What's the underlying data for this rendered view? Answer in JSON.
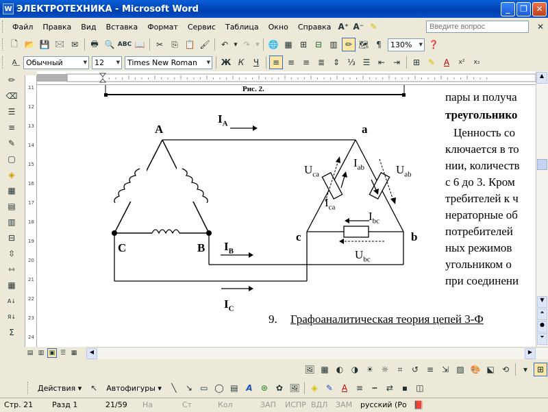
{
  "window": {
    "title": "ЭЛЕКТРОТЕХНИКА - Microsoft Word",
    "app_icon": "W"
  },
  "menu": [
    "Файл",
    "Правка",
    "Вид",
    "Вставка",
    "Формат",
    "Сервис",
    "Таблица",
    "Окно",
    "Справка"
  ],
  "question_placeholder": "Введите вопрос",
  "toolbar": {
    "zoom": "130%"
  },
  "format": {
    "style": "Обычный",
    "size": "12",
    "font": "Times New Roman",
    "bold": "Ж",
    "italic": "К",
    "underline": "Ч"
  },
  "document": {
    "caption": "Рис. 2.",
    "lines": [
      "пары  и  получа",
      "треугольнико",
      "Ценность  со",
      "ключается  в то",
      "нии, количеств",
      "с 6 до 3.  Кром",
      "требителей к ч",
      "нераторные об",
      "потребителей",
      "ных режимов",
      "угольником  о",
      "при соединени"
    ],
    "heading_number": "9.",
    "heading": "Графоаналитическая  теория  цепей 3-Ф",
    "circuit": {
      "node_A": "A",
      "node_B": "B",
      "node_C": "C",
      "node_a": "a",
      "node_b": "b",
      "node_c": "c",
      "current_A": "I",
      "current_A_sub": "A",
      "current_B": "I",
      "current_B_sub": "B",
      "current_C": "I",
      "current_C_sub": "C",
      "current_ab": "I",
      "current_ab_sub": "ab",
      "current_bc": "I",
      "current_bc_sub": "bc",
      "current_ca": "I",
      "current_ca_sub": "ca",
      "voltage_ab": "U",
      "voltage_ab_sub": "ab",
      "voltage_bc": "U",
      "voltage_bc_sub": "bc",
      "voltage_ca": "U",
      "voltage_ca_sub": "ca"
    }
  },
  "draw": {
    "actions": "Действия",
    "autoshapes": "Автофигуры"
  },
  "status": {
    "page": "Стр. 21",
    "section": "Разд  1",
    "pages": "21/59",
    "at": "На",
    "line": "Ст",
    "col": "Кол",
    "rec": "ЗАП",
    "trk": "ИСПР",
    "ext": "ВДЛ",
    "ovr": "ЗАМ",
    "lang": "русский (Ро"
  }
}
